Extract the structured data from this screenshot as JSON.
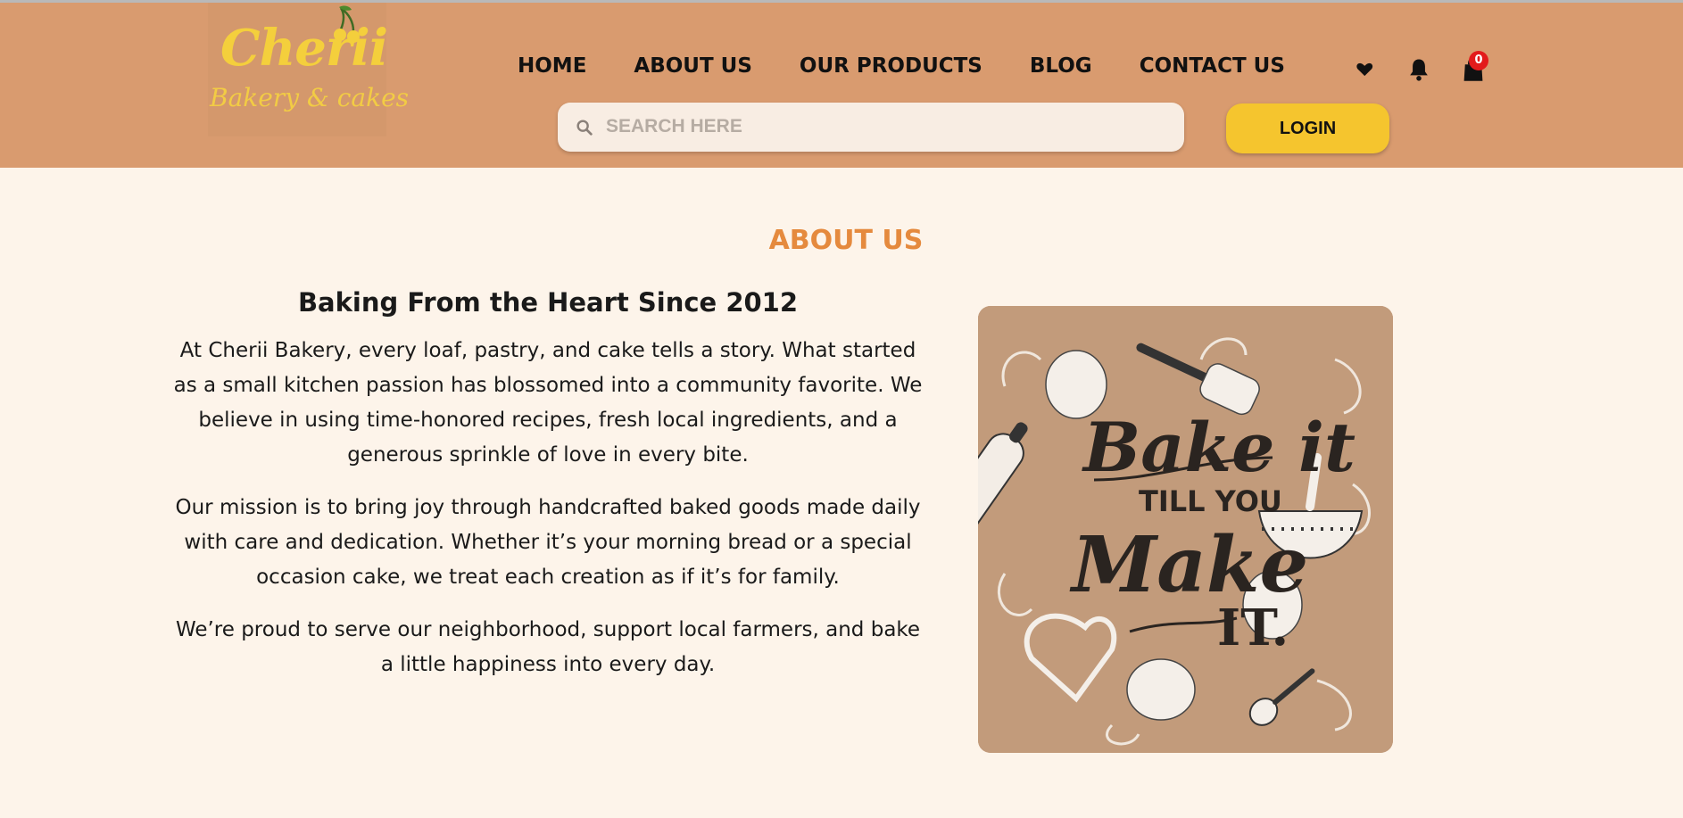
{
  "brand": {
    "name": "Cherii",
    "tagline": "Bakery & cakes"
  },
  "nav": {
    "items": [
      "HOME",
      "ABOUT US",
      "OUR PRODUCTS",
      "BLOG",
      "CONTACT US"
    ]
  },
  "header_icons": {
    "favorites": "heart-icon",
    "notifications": "bell-icon",
    "cart": "shopping-bag-icon",
    "cart_count": "0"
  },
  "search": {
    "placeholder": "SEARCH HERE",
    "value": ""
  },
  "login": {
    "label": "LOGIN"
  },
  "about": {
    "title": "ABOUT US",
    "heading": "Baking From the Heart Since 2012",
    "paragraphs": [
      "At Cherii Bakery, every loaf, pastry, and cake tells a story. What started as a small kitchen passion has blossomed into a community favorite. We believe in using time-honored recipes, fresh local ingredients, and a generous sprinkle of love in every bite.",
      "Our mission is to bring joy through handcrafted baked goods made daily with care and dedication. Whether it’s your morning bread or a special occasion cake, we treat each creation as if it’s for family.",
      "We’re proud to serve our neighborhood, support local farmers, and bake a little happiness into every day."
    ]
  },
  "poster": {
    "line1": "Bake it",
    "line2": "TILL YOU",
    "line3": "Make",
    "line4": "IT."
  },
  "colors": {
    "header_bg": "#d99b6f",
    "page_bg": "#fdf4ea",
    "accent": "#e58a3e",
    "login_bg": "#f5c52e",
    "badge": "#e31b1b"
  }
}
